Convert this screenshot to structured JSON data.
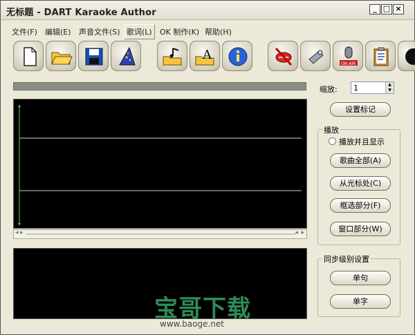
{
  "window": {
    "title": "无标题 - DART Karaoke Author",
    "controls": [
      "_",
      "□",
      "×"
    ]
  },
  "menu": [
    {
      "label": "文件(F)"
    },
    {
      "label": "编辑(E)"
    },
    {
      "label": "声音文件(S)"
    },
    {
      "label": "歌词(L)"
    },
    {
      "label": "OK 制作(K)"
    },
    {
      "label": "帮助(H)"
    }
  ],
  "toolbar": {
    "icons": [
      "new-file-icon",
      "open-folder-icon",
      "save-icon",
      "wizard-hat-icon",
      "open-music-folder-icon",
      "open-font-folder-icon",
      "info-icon",
      "mute-icon",
      "mixer-icon",
      "on-air-mic-icon",
      "clipboard-icon",
      "record-icon"
    ]
  },
  "zoom": {
    "label": "缩放:",
    "value": "1"
  },
  "buttons": {
    "set_marker": "设置标记",
    "whole_song": "歌曲全部(A)",
    "from_cursor": "从光标处(C)",
    "selection": "框选部分(F)",
    "window_part": "窗口部分(W)",
    "single_line": "单句",
    "single_char": "单字"
  },
  "playback": {
    "group_label": "播放",
    "radio_label": "播放并且显示"
  },
  "sync": {
    "group_label": "同步级别设置"
  },
  "watermark": {
    "brand": "宝哥下载",
    "url": "www.baoge.net"
  },
  "colors": {
    "wave_bg": "#000000",
    "grid_line": "#d6d3b8",
    "marker": "#5ad65a",
    "watermark": "#2e8b57"
  }
}
